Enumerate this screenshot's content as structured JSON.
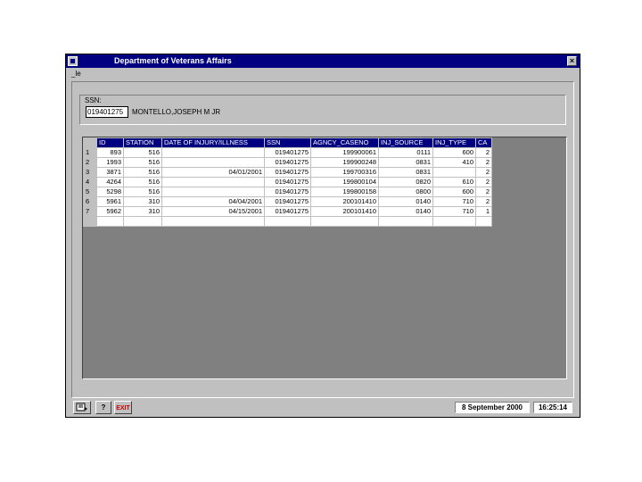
{
  "window": {
    "title": "Department of Veterans Affairs",
    "close_glyph": "×",
    "menu_label": "_le"
  },
  "ssn": {
    "label": "SSN:",
    "value": "019401275",
    "name": "MONTELLO,JOSEPH M JR"
  },
  "grid": {
    "columns": [
      "ID",
      "STATION",
      "DATE OF INJURY/ILLNESS",
      "SSN",
      "AGNCY_CASENO",
      "INJ_SOURCE",
      "INJ_TYPE",
      "CA"
    ],
    "rows": [
      {
        "num": "1",
        "cells": [
          "893",
          "516",
          "",
          "019401275",
          "199900061",
          "0111",
          "600",
          "2"
        ]
      },
      {
        "num": "2",
        "cells": [
          "1993",
          "516",
          "",
          "019401275",
          "199900248",
          "0831",
          "410",
          "2"
        ]
      },
      {
        "num": "3",
        "cells": [
          "3871",
          "516",
          "04/01/2001",
          "019401275",
          "199700316",
          "0831",
          "",
          "2"
        ]
      },
      {
        "num": "4",
        "cells": [
          "4264",
          "516",
          "",
          "019401275",
          "199800104",
          "0820",
          "610",
          "2"
        ]
      },
      {
        "num": "5",
        "cells": [
          "5298",
          "516",
          "",
          "019401275",
          "199800158",
          "0800",
          "600",
          "2"
        ]
      },
      {
        "num": "6",
        "cells": [
          "5961",
          "310",
          "04/04/2001",
          "019401275",
          "200101410",
          "0140",
          "710",
          "2"
        ]
      },
      {
        "num": "7",
        "cells": [
          "5962",
          "310",
          "04/15/2001",
          "019401275",
          "200101410",
          "0140",
          "710",
          "1"
        ]
      },
      {
        "num": "",
        "cells": [
          "",
          "",
          "",
          "",
          "",
          "",
          "",
          ""
        ]
      }
    ]
  },
  "statusbar": {
    "exit_label": "EXIT",
    "help_glyph": "?",
    "date": "8 September 2000",
    "time": "16:25:14",
    "exit_color": "#cc0000",
    "icons": [
      "report-icon",
      "help-icon",
      "exit-icon"
    ]
  }
}
